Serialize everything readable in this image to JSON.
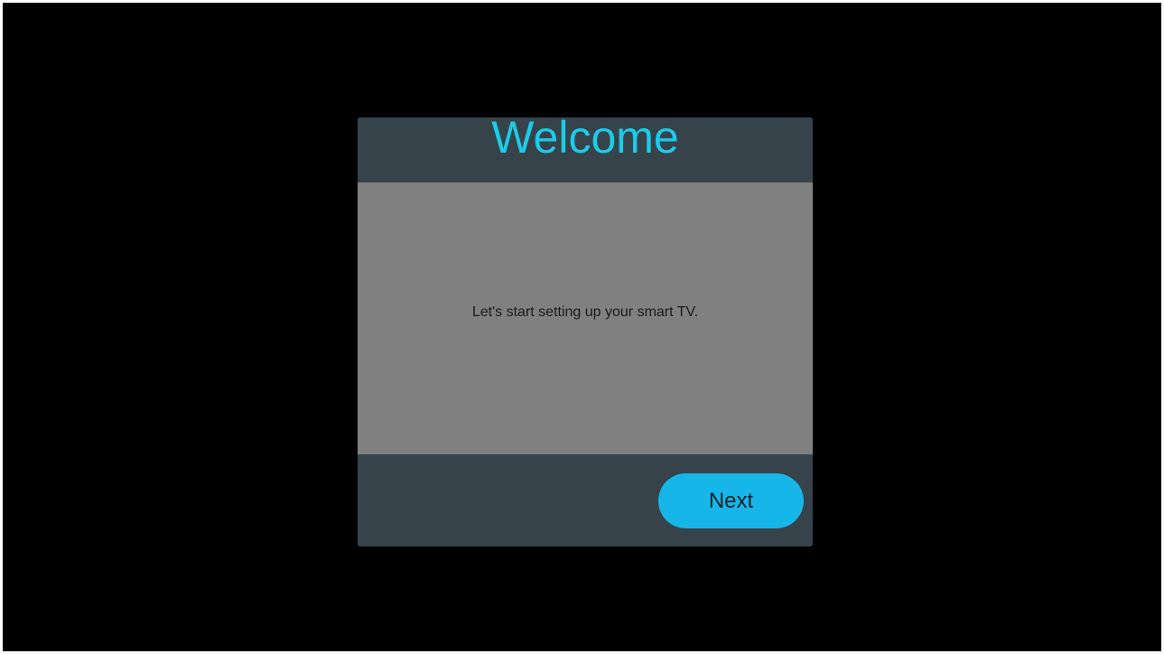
{
  "dialog": {
    "title": "Welcome",
    "message": "Let's start setting  up your smart TV.",
    "next_label": "Next"
  },
  "colors": {
    "title": "#1ccbe8",
    "accent": "#17b6e9",
    "panel": "#36434a",
    "body": "#808080",
    "screen": "#000000"
  }
}
